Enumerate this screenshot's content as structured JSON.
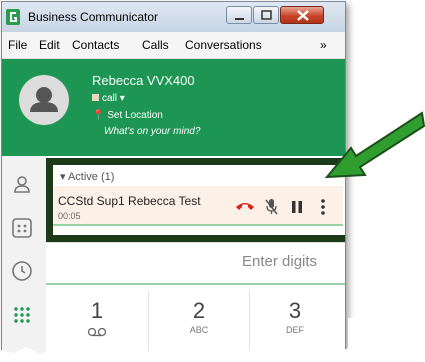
{
  "window": {
    "title": "Business Communicator"
  },
  "menu": {
    "items": [
      "File",
      "Edit",
      "Contacts",
      "Calls",
      "Conversations"
    ],
    "more": "»"
  },
  "user": {
    "name": "Rebecca VVX400",
    "status": "call ▾",
    "location": "Set Location",
    "mood_placeholder": "What's on your mind?"
  },
  "active": {
    "header": "▾  Active (1)",
    "call": {
      "name": "CCStd Sup1 Rebecca Test",
      "duration": "00:05"
    }
  },
  "dialer": {
    "placeholder": "Enter digits",
    "keys": [
      {
        "digit": "1",
        "letters": ""
      },
      {
        "digit": "2",
        "letters": "ABC"
      },
      {
        "digit": "3",
        "letters": "DEF"
      }
    ]
  },
  "colors": {
    "accent": "#1d9653",
    "highlight_box": "#1a3a1a",
    "arrow": "#2f9e2f",
    "hangup": "#e0221b"
  }
}
